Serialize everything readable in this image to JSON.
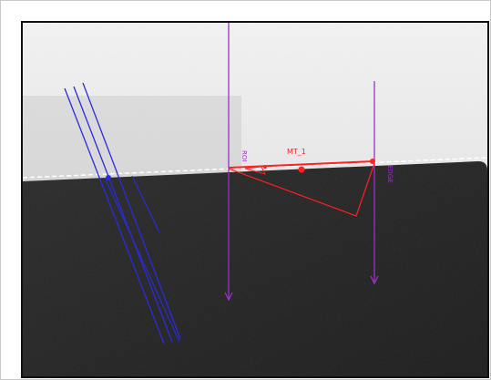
{
  "camera_view": {
    "name": "inspection-image"
  },
  "measurement": {
    "label": "MT_1",
    "color": "#ff2020",
    "reference_line_color": "#ffffff"
  },
  "rulers": {
    "color": "#9b30c8",
    "left_label": "ROI",
    "right_label": "EDGE"
  },
  "edge_tool": {
    "color": "#2a2ae0"
  },
  "colors": {
    "frame_border": "#101010",
    "background_light": "#eeeeee",
    "background_dark": "#242424"
  }
}
